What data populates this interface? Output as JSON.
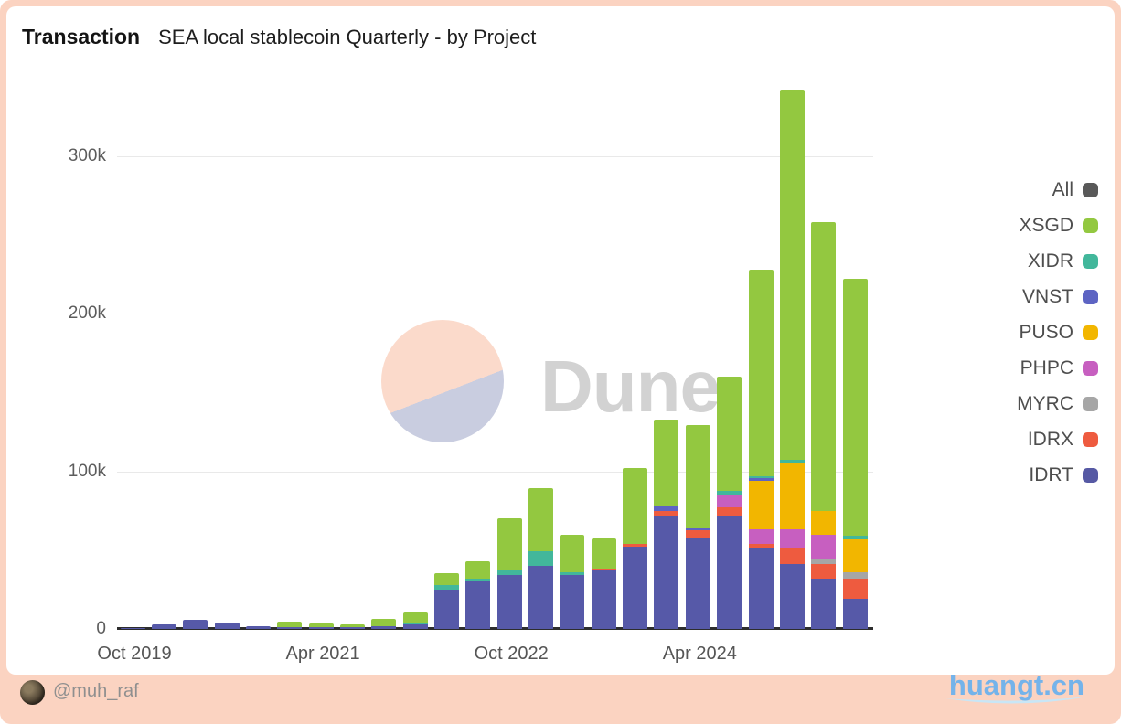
{
  "header": {
    "title": "Transaction",
    "subtitle": "SEA local stablecoin Quarterly - by Project"
  },
  "watermark": {
    "text": "Dune"
  },
  "footer": {
    "handle": "@muh_raf",
    "logo_text": "huangt.cn"
  },
  "theme": {
    "peach_border": "#fbd3c1",
    "watermark_peach": "#fbdacb",
    "watermark_lavender": "#c9cde0",
    "logo_blue": "#74b3ea",
    "logo_swoosh": "#c8e6f6"
  },
  "legend": {
    "items": [
      {
        "label": "All",
        "color": "#595959"
      },
      {
        "label": "XSGD",
        "color": "#93c840"
      },
      {
        "label": "XIDR",
        "color": "#42b79b"
      },
      {
        "label": "VNST",
        "color": "#5d64c3"
      },
      {
        "label": "PUSO",
        "color": "#f2b600"
      },
      {
        "label": "PHPC",
        "color": "#c75fc0"
      },
      {
        "label": "MYRC",
        "color": "#a6a6a6"
      },
      {
        "label": "IDRX",
        "color": "#ee5b3f"
      },
      {
        "label": "IDRT",
        "color": "#5659a4"
      }
    ]
  },
  "chart_data": {
    "type": "bar",
    "stacked": true,
    "title": "Transaction — SEA local stablecoin Quarterly - by Project",
    "values_in_thousands": true,
    "ylim": [
      0,
      360
    ],
    "grid": "horizontal",
    "legend_position": "right",
    "y_ticks": [
      {
        "label": "0",
        "value": 0
      },
      {
        "label": "100k",
        "value": 100
      },
      {
        "label": "200k",
        "value": 200
      },
      {
        "label": "300k",
        "value": 300
      }
    ],
    "x": [
      "Oct 2019",
      "Jan 2020",
      "Apr 2020",
      "Jul 2020",
      "Oct 2020",
      "Jan 2021",
      "Apr 2021",
      "Jul 2021",
      "Oct 2021",
      "Jan 2022",
      "Apr 2022",
      "Jul 2022",
      "Oct 2022",
      "Jan 2023",
      "Apr 2023",
      "Jul 2023",
      "Oct 2023",
      "Jan 2024",
      "Apr 2024",
      "Jul 2024",
      "Oct 2024",
      "Jan 2025",
      "Apr 2025",
      "Jul 2025"
    ],
    "x_ticks": [
      {
        "index": 0,
        "label": "Oct 2019"
      },
      {
        "index": 6,
        "label": "Apr 2021"
      },
      {
        "index": 12,
        "label": "Oct 2022"
      },
      {
        "index": 18,
        "label": "Apr 2024"
      }
    ],
    "series": [
      {
        "name": "IDRT",
        "color": "#5659a8",
        "values": [
          0.3,
          3,
          6,
          4,
          2,
          1,
          1,
          1,
          2,
          3,
          25,
          30,
          34,
          40,
          34,
          37,
          52,
          72,
          58,
          72,
          51,
          41,
          32,
          19
        ]
      },
      {
        "name": "IDRX",
        "color": "#ee5b3f",
        "values": [
          0,
          0,
          0,
          0,
          0,
          0,
          0,
          0,
          0,
          0,
          0,
          0,
          0,
          0,
          0,
          1.5,
          2,
          2.5,
          4.5,
          5,
          3,
          10,
          9,
          13
        ]
      },
      {
        "name": "MYRC",
        "color": "#a6a6a6",
        "values": [
          0,
          0,
          0,
          0,
          0,
          0,
          0,
          0,
          0,
          0,
          0,
          0,
          0,
          0,
          0,
          0,
          0,
          0,
          0,
          0,
          0,
          0,
          3,
          4
        ]
      },
      {
        "name": "PHPC",
        "color": "#c75fc0",
        "values": [
          0,
          0,
          0,
          0,
          0,
          0,
          0,
          0,
          0,
          0,
          0,
          0,
          0,
          0,
          0,
          0,
          0,
          0,
          0,
          7.5,
          9,
          12,
          16,
          0
        ]
      },
      {
        "name": "PUSO",
        "color": "#f2b600",
        "values": [
          0,
          0,
          0,
          0,
          0,
          0,
          0,
          0,
          0,
          0,
          0,
          0,
          0,
          0,
          0,
          0,
          0,
          0,
          0,
          0,
          31,
          42,
          15,
          21
        ]
      },
      {
        "name": "VNST",
        "color": "#5d64c3",
        "values": [
          0,
          0,
          0,
          0,
          0,
          0,
          0,
          0,
          0,
          0,
          0,
          0,
          0,
          0,
          0,
          0,
          0,
          3.5,
          1,
          1,
          1.5,
          0,
          0,
          0
        ]
      },
      {
        "name": "XIDR",
        "color": "#42b79b",
        "values": [
          0,
          0,
          0,
          0,
          0,
          0,
          0,
          0,
          0,
          1,
          3,
          2,
          3,
          9,
          2,
          0,
          0,
          0,
          0,
          2,
          1.5,
          2.5,
          0,
          2
        ]
      },
      {
        "name": "XSGD",
        "color": "#93c840",
        "values": [
          0,
          0,
          0,
          0,
          0,
          3.5,
          2.5,
          2,
          4.5,
          6.5,
          7.5,
          11,
          33,
          40,
          24,
          19,
          48,
          55,
          66,
          72.5,
          131,
          234.5,
          183,
          163
        ]
      }
    ],
    "totals_thousands": [
      0.3,
      3,
      6,
      4,
      2,
      4.5,
      3.5,
      3,
      6.5,
      10.5,
      35.5,
      43,
      70,
      89,
      60,
      57.5,
      102,
      133,
      129.5,
      160,
      228,
      342,
      258,
      222
    ]
  }
}
